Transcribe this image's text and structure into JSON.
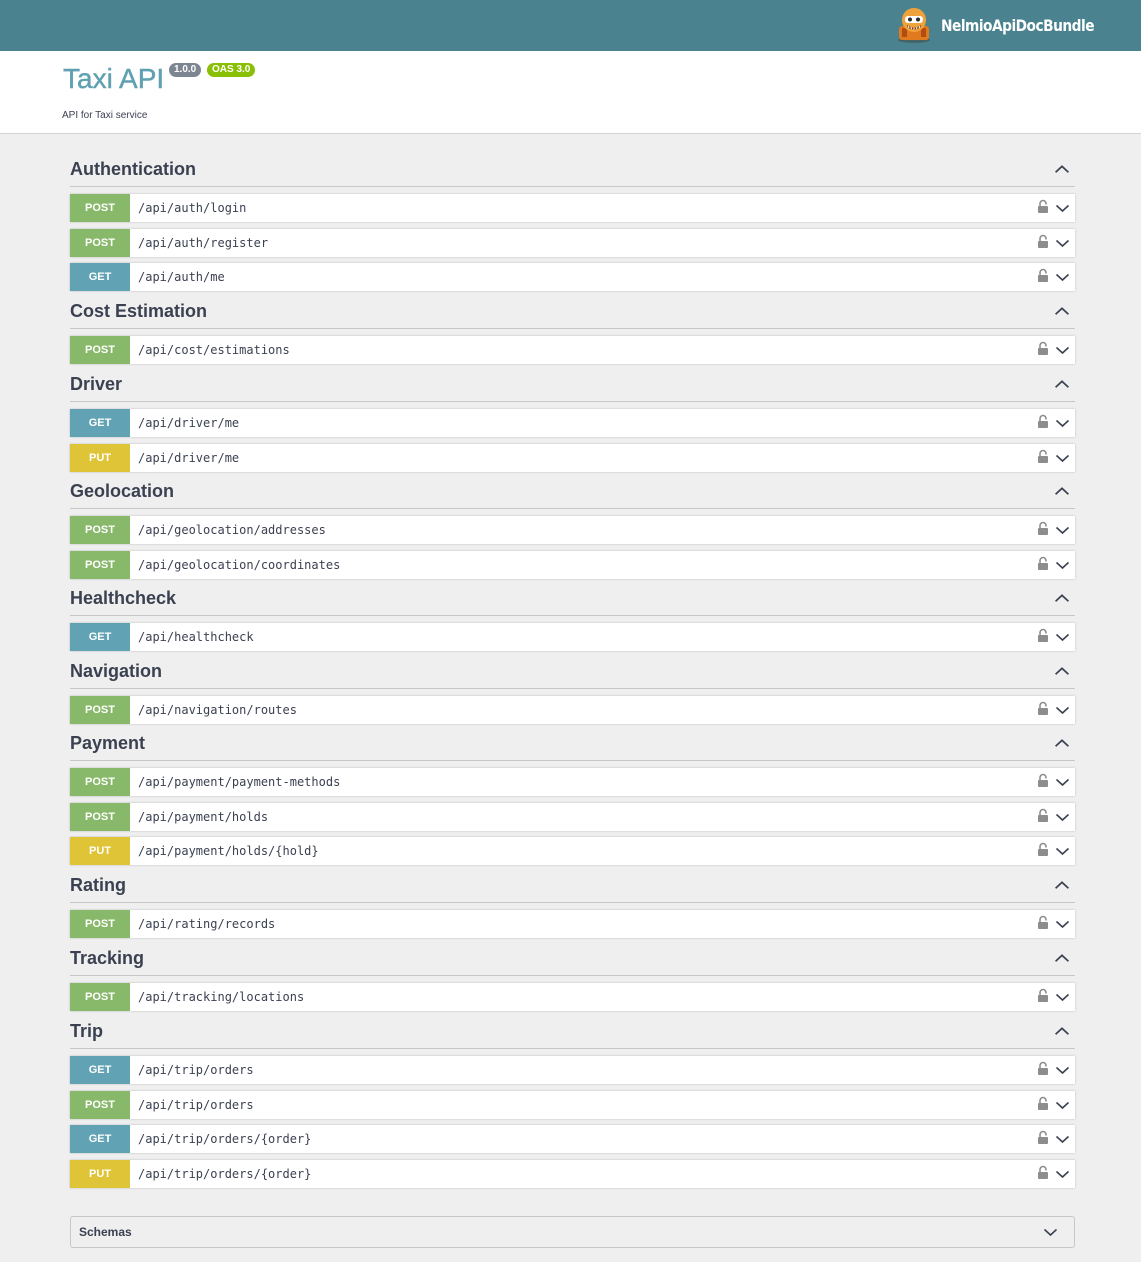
{
  "topbar": {
    "brand_name": "NelmioApiDocBundle",
    "logo_icon": "nelmio-mascot-icon",
    "background_color": "#4a838f"
  },
  "info": {
    "title": "Taxi API",
    "version": "1.0.0",
    "oas": "OAS 3.0",
    "description": "API for Taxi service"
  },
  "colors": {
    "post": "#88b86a",
    "get": "#61a3b4",
    "put": "#dfc437"
  },
  "icons": {
    "lock": "lock-icon",
    "expand": "chevron-down-icon",
    "collapse": "chevron-up-icon"
  },
  "tags": [
    {
      "name": "Authentication",
      "operations": [
        {
          "method": "POST",
          "path": "/api/auth/login"
        },
        {
          "method": "POST",
          "path": "/api/auth/register"
        },
        {
          "method": "GET",
          "path": "/api/auth/me"
        }
      ]
    },
    {
      "name": "Cost Estimation",
      "operations": [
        {
          "method": "POST",
          "path": "/api/cost/estimations"
        }
      ]
    },
    {
      "name": "Driver",
      "operations": [
        {
          "method": "GET",
          "path": "/api/driver/me"
        },
        {
          "method": "PUT",
          "path": "/api/driver/me"
        }
      ]
    },
    {
      "name": "Geolocation",
      "operations": [
        {
          "method": "POST",
          "path": "/api/geolocation/addresses"
        },
        {
          "method": "POST",
          "path": "/api/geolocation/coordinates"
        }
      ]
    },
    {
      "name": "Healthcheck",
      "operations": [
        {
          "method": "GET",
          "path": "/api/healthcheck"
        }
      ]
    },
    {
      "name": "Navigation",
      "operations": [
        {
          "method": "POST",
          "path": "/api/navigation/routes"
        }
      ]
    },
    {
      "name": "Payment",
      "operations": [
        {
          "method": "POST",
          "path": "/api/payment/payment-methods"
        },
        {
          "method": "POST",
          "path": "/api/payment/holds"
        },
        {
          "method": "PUT",
          "path": "/api/payment/holds/{hold}"
        }
      ]
    },
    {
      "name": "Rating",
      "operations": [
        {
          "method": "POST",
          "path": "/api/rating/records"
        }
      ]
    },
    {
      "name": "Tracking",
      "operations": [
        {
          "method": "POST",
          "path": "/api/tracking/locations"
        }
      ]
    },
    {
      "name": "Trip",
      "operations": [
        {
          "method": "GET",
          "path": "/api/trip/orders"
        },
        {
          "method": "POST",
          "path": "/api/trip/orders"
        },
        {
          "method": "GET",
          "path": "/api/trip/orders/{order}"
        },
        {
          "method": "PUT",
          "path": "/api/trip/orders/{order}"
        }
      ]
    }
  ],
  "schemas": {
    "label": "Schemas"
  }
}
